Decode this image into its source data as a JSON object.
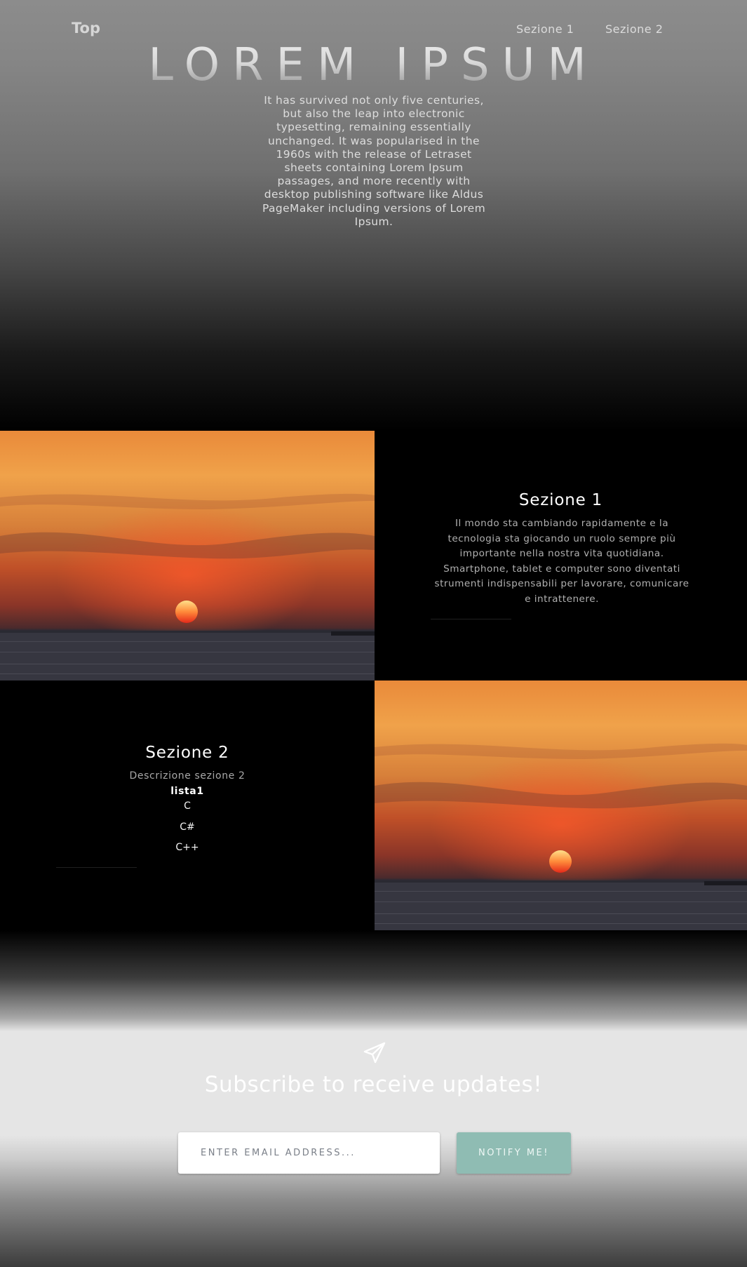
{
  "nav": {
    "brand": "Top",
    "links": [
      "Sezione 1",
      "Sezione 2"
    ]
  },
  "hero": {
    "title": "LOREM IPSUM",
    "text": "It has survived not only five centuries, but also the leap into electronic typesetting, remaining essentially unchanged. It was popularised in the 1960s with the release of Letraset sheets containing Lorem Ipsum passages, and more recently with desktop publishing software like Aldus PageMaker including versions of Lorem Ipsum."
  },
  "section1": {
    "title": "Sezione 1",
    "text": "Il mondo sta cambiando rapidamente e la tecnologia sta giocando un ruolo sempre più importante nella nostra vita quotidiana. Smartphone, tablet e computer sono diventati strumenti indispensabili per lavorare, comunicare e intrattenere.",
    "image": "sunset-over-sea"
  },
  "section2": {
    "title": "Sezione 2",
    "description": "Descrizione sezione 2",
    "list_title": "lista1",
    "list_items": [
      "C",
      "C#",
      "C++"
    ],
    "image": "sunset-over-sea"
  },
  "subscribe": {
    "icon": "paper-plane-icon",
    "title": "Subscribe to receive updates!",
    "email_placeholder": "ENTER EMAIL ADDRESS...",
    "button_label": "NOTIFY ME!",
    "button_color": "#8fbcb3"
  }
}
